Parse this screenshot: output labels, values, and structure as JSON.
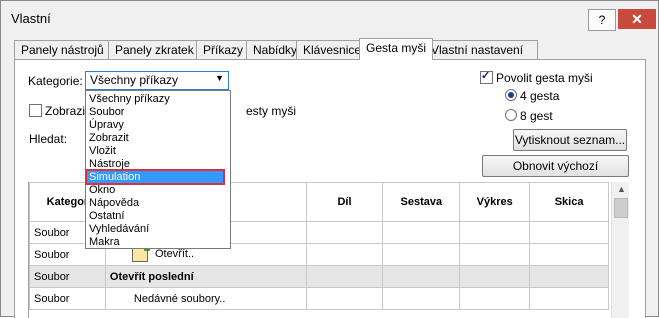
{
  "window": {
    "title": "Vlastní",
    "help_glyph": "?",
    "close_glyph": "✕"
  },
  "tabs": [
    {
      "label": "Panely nástrojů",
      "active": false
    },
    {
      "label": "Panely zkratek",
      "active": false
    },
    {
      "label": "Příkazy",
      "active": false
    },
    {
      "label": "Nabídky",
      "active": false
    },
    {
      "label": "Klávesnice",
      "active": false
    },
    {
      "label": "Gesta myši",
      "active": true
    },
    {
      "label": "Vlastní  nastavení",
      "active": false
    }
  ],
  "filters": {
    "category_label": "Kategorie:",
    "category_value": "Všechny příkazy",
    "show_label_partial": "Zobrazit",
    "show_label_suffix": "esty myši",
    "search_label": "Hledat:"
  },
  "right_panel": {
    "enable_label": "Povolit gesta myši",
    "enable_checked": true,
    "option_4": "4 gesta",
    "option_8": "8 gest",
    "selected_option": "4 gesta",
    "print_button": "Vytisknout seznam...",
    "reset_button": "Obnovit výchozí"
  },
  "dropdown": {
    "items": [
      "Všechny příkazy",
      "Soubor",
      "Úpravy",
      "Zobrazit",
      "Vložit",
      "Nástroje",
      "Simulation",
      "Okno",
      "Nápověda",
      "Ostatní",
      "Vyhledávání",
      "Makra"
    ],
    "highlighted": "Simulation"
  },
  "table": {
    "columns": [
      "Kategor",
      "",
      "Díl",
      "Sestava",
      "Výkres",
      "Skica"
    ],
    "rows": [
      {
        "category": "Soubor",
        "command": "",
        "group": false
      },
      {
        "category": "Soubor",
        "command": "Otevřít..",
        "group": false,
        "icon": "open-file-icon"
      },
      {
        "category": "Soubor",
        "command": "Otevřít poslední",
        "group": true
      },
      {
        "category": "Soubor",
        "command": "Nedávné soubory..",
        "group": false
      }
    ]
  },
  "colors": {
    "accent": "#3399ff",
    "highlight_border": "#d9323c",
    "close_bg": "#c84a3c"
  }
}
